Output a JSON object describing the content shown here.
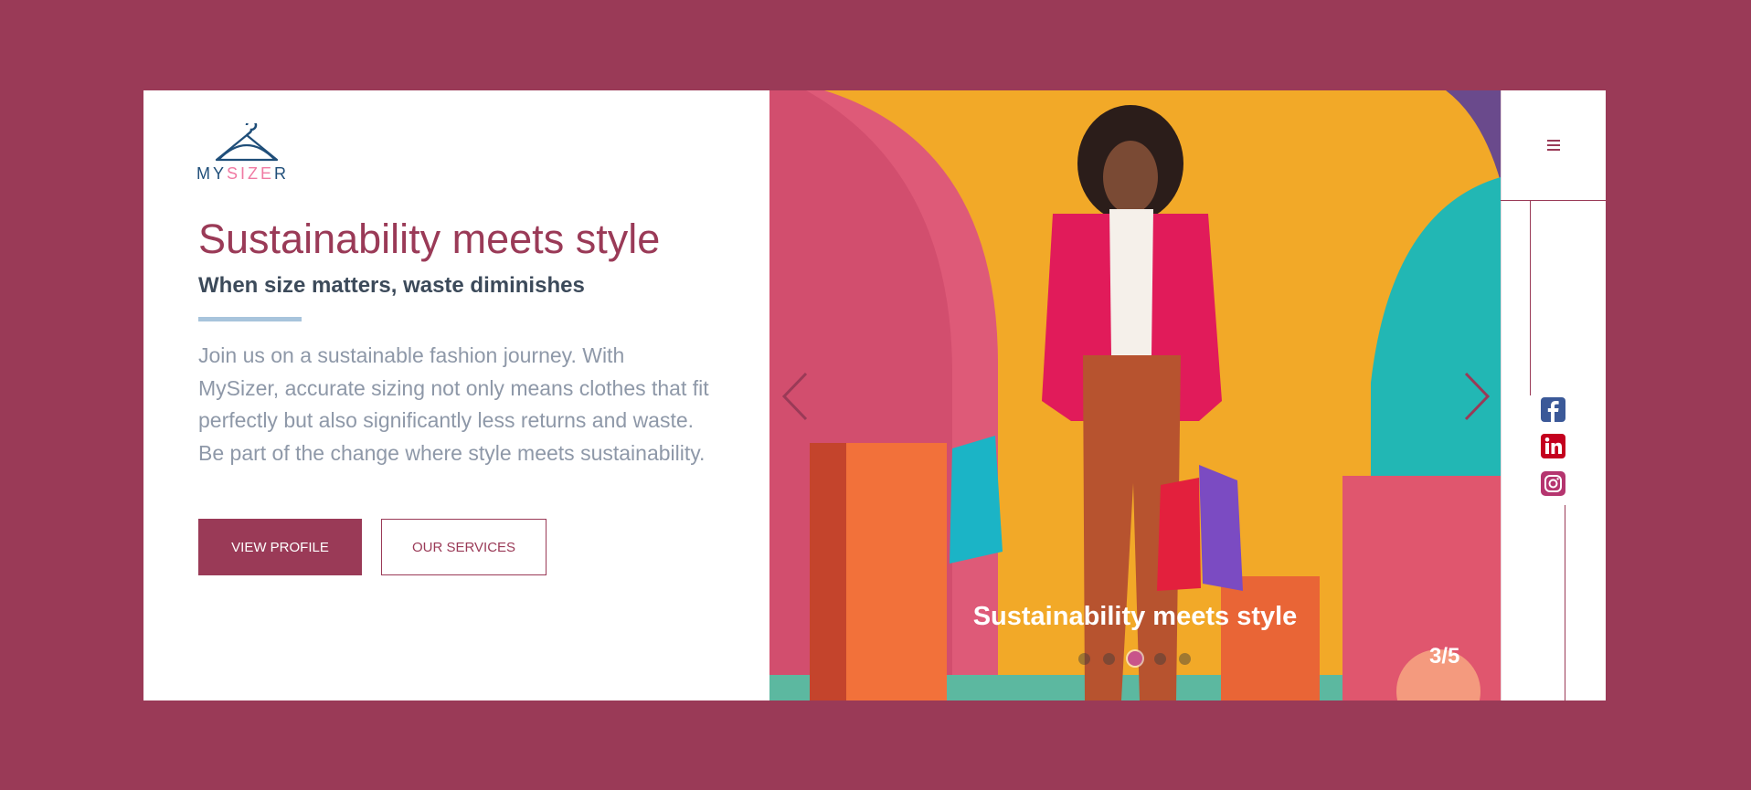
{
  "brand": {
    "logo_part1": "MY",
    "logo_part2": "SIZE",
    "logo_part3": "R"
  },
  "hero": {
    "title": "Sustainability meets style",
    "subtitle": "When size matters, waste diminishes",
    "description": "Join us on a sustainable fashion journey. With MySizer, accurate sizing not only means clothes that fit perfectly but also significantly less returns and waste. Be part of the change where style meets sustainability.",
    "primary_button": "VIEW PROFILE",
    "secondary_button": "OUR SERVICES"
  },
  "slider": {
    "caption": "Sustainability meets style",
    "counter": "3/5",
    "total_slides": 5,
    "active_index": 3
  },
  "rail": {
    "menu_icon": "hamburger-icon",
    "social": [
      "facebook-icon",
      "linkedin-icon",
      "instagram-icon"
    ]
  },
  "colors": {
    "background": "#9a3a57",
    "accent": "#9a3a57",
    "text_dark": "#3c4a5a",
    "text_muted": "#8e98a8",
    "divider": "#a8c4dc",
    "facebook": "#3b5998",
    "linkedin": "#c4001e",
    "instagram": "#b5356f"
  }
}
